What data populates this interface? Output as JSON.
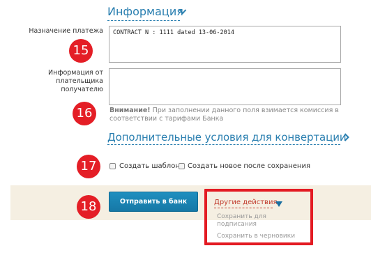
{
  "sections": {
    "info_title": "Информация",
    "conversion_title": "Дополнительные условия для конвертации"
  },
  "fields": {
    "purpose_label": "Назначение платежа",
    "purpose_value": "CONTRACT N : 1111 dated 13-06-2014",
    "payer_info_label": "Информация от плательщика получателю",
    "payer_info_value": ""
  },
  "note": {
    "strong": "Внимание!",
    "text": " При заполнении данного поля взимается комиссия в соответствии с тарифами Банка"
  },
  "checkboxes": {
    "create_template": "Создать шаблон",
    "create_new_after_save": "Создать новое после сохранения"
  },
  "actions": {
    "send_button": "Отправить в банк",
    "other_actions": "Другие действия",
    "save_for_signing": "Сохранить для подписания",
    "save_to_drafts": "Сохранить в черновики"
  },
  "badges": {
    "b15": "15",
    "b16": "16",
    "b17": "17",
    "b18": "18"
  },
  "colors": {
    "link": "#2a7fb0",
    "badge": "#e41e26",
    "highlight": "#e31b23",
    "button": "#1a82b2",
    "band": "#f5efe2"
  },
  "icons": {
    "info_chevron": "chevron-down-icon",
    "conversion_chevron": "chevron-right-icon",
    "other_actions_caret": "caret-down-icon"
  }
}
